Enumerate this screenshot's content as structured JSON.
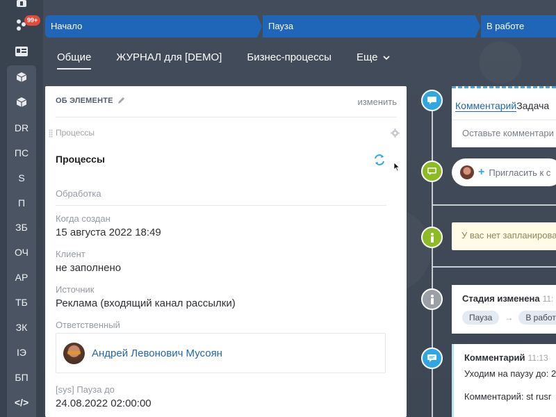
{
  "rail": {
    "badge": "99+",
    "items": [
      "DR",
      "ПС",
      "S",
      "П",
      "ЗБ",
      "ОЧ",
      "AP",
      "ТБ",
      "ЗК",
      "IЭ",
      "БП",
      "</>"
    ]
  },
  "stages": [
    {
      "label": "Начало"
    },
    {
      "label": "Пауза"
    },
    {
      "label": "В работе"
    }
  ],
  "tabs": {
    "items": [
      "Общие",
      "ЖУРНАЛ для [DEMO]",
      "Бизнес-процессы"
    ],
    "more": "Еще"
  },
  "card": {
    "title": "ОБ ЭЛЕМЕНТЕ",
    "edit": "изменить",
    "section_label": "Процессы",
    "processes_title": "Процессы",
    "subsection": "Обработка",
    "fields": {
      "created": {
        "label": "Когда создан",
        "value": "15 августа 2022 18:49"
      },
      "client": {
        "label": "Клиент",
        "value": "не заполнено"
      },
      "source": {
        "label": "Источник",
        "value": "Реклама (входящий канал рассылки)"
      },
      "responsible": {
        "label": "Ответственный",
        "value": "Андрей Левонович Мусоян"
      },
      "pause_until": {
        "label": "[sys] Пауза до",
        "value": "24.08.2022 02:00:00"
      }
    }
  },
  "timeline": {
    "composer": {
      "tab_comment": "Комментарий",
      "tab_task": "Задача",
      "placeholder": "Оставьте комментари"
    },
    "invite": "Пригласить к с",
    "plan_notice": "У вас нет запланирова",
    "stage_change": {
      "title": "Стадия изменена",
      "time": "11:",
      "from": "Пауза",
      "to": "В работ"
    },
    "comment": {
      "title": "Комментарий",
      "time": "11:13",
      "line1": "Уходим на паузу до: 2",
      "line2": "Комментарий: st rusr"
    }
  },
  "colors": {
    "stage_bar": "#1f66b8",
    "timeline_blue": "#2fa7e3",
    "timeline_green": "#8dbb23",
    "timeline_grey": "#9aa0a6"
  }
}
